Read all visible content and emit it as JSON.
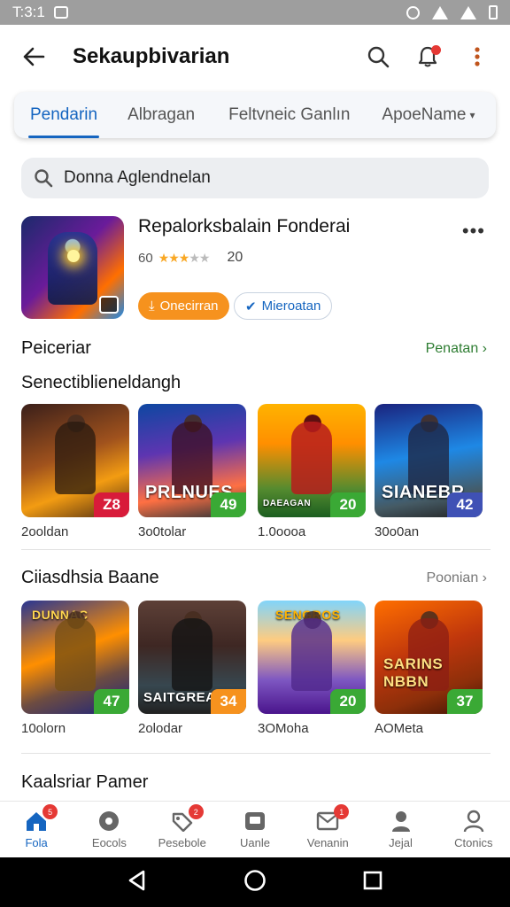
{
  "status_bar": {
    "time": "T:3:1"
  },
  "app_bar": {
    "title": "Sekaupbivarian"
  },
  "tabs": [
    {
      "label": "Pendarin",
      "active": true
    },
    {
      "label": "Albragan",
      "active": false
    },
    {
      "label": "Feltvneic Ganlın",
      "active": false
    },
    {
      "label": "ApoeName",
      "active": false
    }
  ],
  "search": {
    "value": "Donna Aglendnelan"
  },
  "featured": {
    "title": "Repalorksbalain Fonderai",
    "rating_prefix": "60",
    "rating_stars": 3,
    "rating_count": "20",
    "primary_button": "Onecirran",
    "secondary_button": "Mieroatan"
  },
  "section_header": {
    "label": "Peiceriar",
    "link": "Penatan"
  },
  "section_1": {
    "title": "Senectiblieneldangh",
    "games": [
      {
        "count": "2ooldan",
        "score": "Z8",
        "label": "",
        "score_color": "#d81b3a"
      },
      {
        "count": "3o0tolar",
        "score": "49",
        "label": "PRLNUES",
        "score_color": "#3aa935"
      },
      {
        "count": "1.0oooa",
        "score": "20",
        "label": "DAEAGAN",
        "score_color": "#3aa935"
      },
      {
        "count": "30o0an",
        "score": "42",
        "label": "SIANEBR",
        "score_color": "#3f51b5"
      }
    ]
  },
  "section_2": {
    "title": "Ciiasdhsia Baane",
    "link": "Poonian",
    "games": [
      {
        "count": "10olorn",
        "score": "47",
        "label": "DUNNAC",
        "score_color": "#3aa935"
      },
      {
        "count": "2olodar",
        "score": "34",
        "label": "SAITGREAS",
        "score_color": "#f6921e"
      },
      {
        "count": "3OMoha",
        "score": "20",
        "label": "SENGROS",
        "score_color": "#3aa935"
      },
      {
        "count": "AOMeta",
        "score": "37",
        "label": "SARINS NBBN",
        "score_color": "#3aa935"
      }
    ]
  },
  "section_3": {
    "title": "Kaalsriar Pamer"
  },
  "bottom_nav": [
    {
      "label": "Fola",
      "badge": "5",
      "active": true,
      "icon": "home-icon"
    },
    {
      "label": "Eocols",
      "badge": "",
      "active": false,
      "icon": "circle-icon"
    },
    {
      "label": "Pesebole",
      "badge": "2",
      "active": false,
      "icon": "tag-icon"
    },
    {
      "label": "Uanle",
      "badge": "",
      "active": false,
      "icon": "card-icon"
    },
    {
      "label": "Venanin",
      "badge": "1",
      "active": false,
      "icon": "mail-icon"
    },
    {
      "label": "Jejal",
      "badge": "",
      "active": false,
      "icon": "user-icon"
    },
    {
      "label": "Ctonics",
      "badge": "",
      "active": false,
      "icon": "profile-icon"
    }
  ],
  "colors": {
    "accent": "#1565c0",
    "link_green": "#2e7d32",
    "orange": "#f6921e",
    "badge_red": "#e53935"
  }
}
